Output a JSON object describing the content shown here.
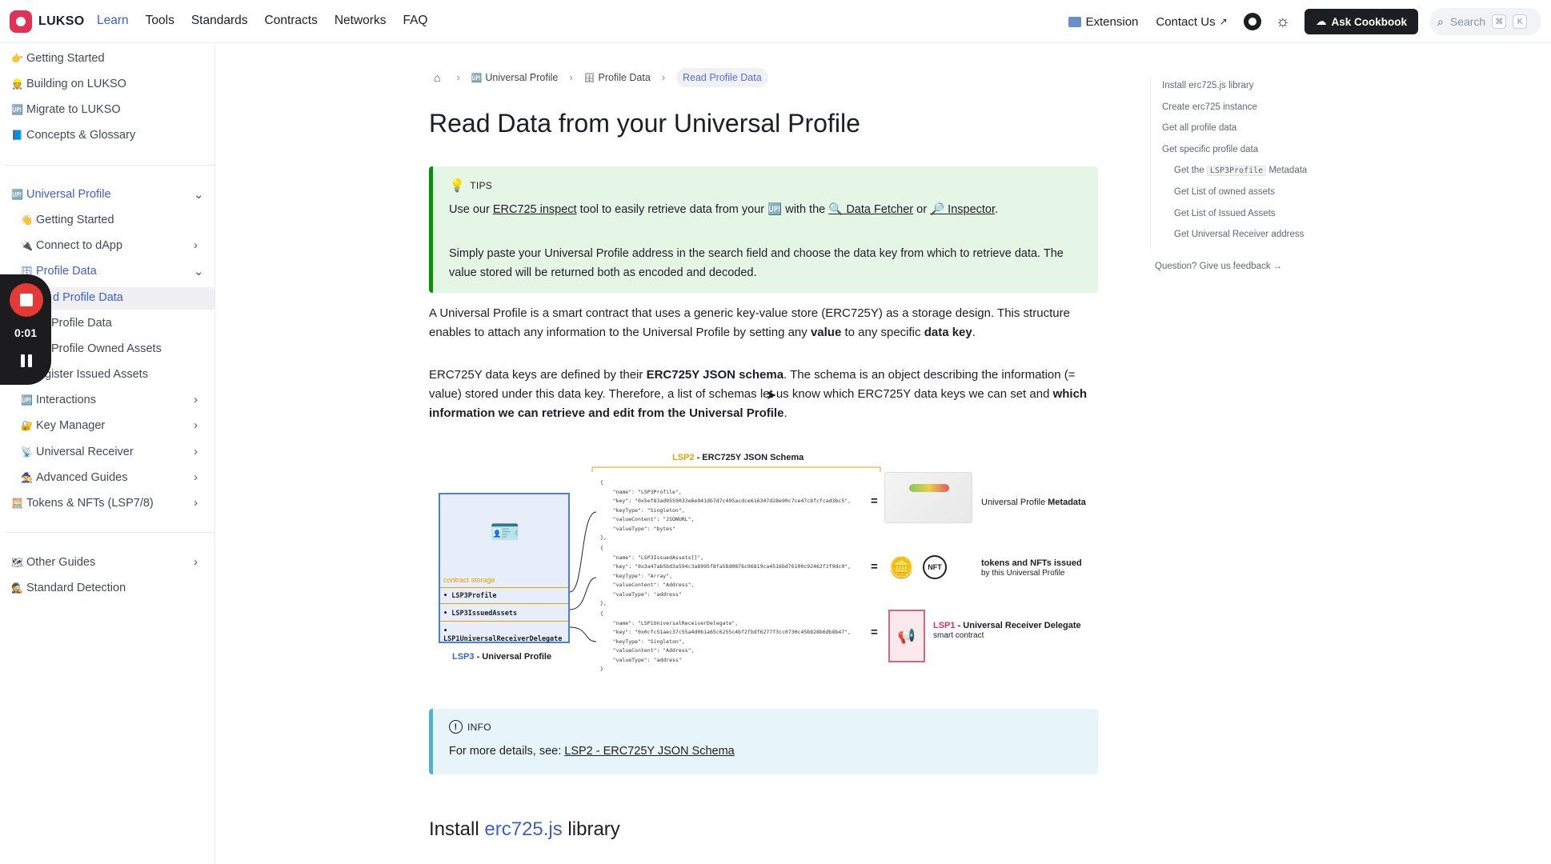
{
  "brand": {
    "name": "LUKSO"
  },
  "nav": {
    "links": [
      "Learn",
      "Tools",
      "Standards",
      "Contracts",
      "Networks",
      "FAQ"
    ],
    "extension": "Extension",
    "contact": "Contact Us",
    "ask": "Ask Cookbook",
    "search_placeholder": "Search",
    "kbd1": "⌘",
    "kbd2": "K"
  },
  "sidebar": {
    "items": [
      {
        "icon": "👉",
        "label": "Getting Started"
      },
      {
        "icon": "👷",
        "label": "Building on LUKSO"
      },
      {
        "icon": "🆙",
        "label": "Migrate to LUKSO"
      },
      {
        "icon": "📘",
        "label": "Concepts & Glossary"
      },
      {
        "icon": "🆙",
        "label": "Universal Profile"
      },
      {
        "icon": "👋",
        "label": "Getting Started"
      },
      {
        "icon": "🔌",
        "label": "Connect to dApp"
      },
      {
        "icon": "🗄",
        "label": "Profile Data"
      },
      {
        "icon": "",
        "label": "d Profile Data"
      },
      {
        "icon": "",
        "label": "Profile Data"
      },
      {
        "icon": "",
        "label": "Profile Owned Assets"
      },
      {
        "icon": "",
        "label": "gister Issued Assets"
      },
      {
        "icon": "🆙",
        "label": "Interactions"
      },
      {
        "icon": "🔐",
        "label": "Key Manager"
      },
      {
        "icon": "📡",
        "label": "Universal Receiver"
      },
      {
        "icon": "🧙",
        "label": "Advanced Guides"
      },
      {
        "icon": "🧮",
        "label": "Tokens & NFTs (LSP7/8)"
      },
      {
        "icon": "🗺",
        "label": "Other Guides"
      },
      {
        "icon": "🕵",
        "label": "Standard Detection"
      }
    ]
  },
  "recorder": {
    "time": "0:01"
  },
  "breadcrumb": {
    "items": [
      "Universal Profile",
      "Profile Data",
      "Read Profile Data"
    ]
  },
  "page": {
    "title": "Read Data from your Universal Profile"
  },
  "tip": {
    "label": "TIPS",
    "p1_a": "Use our ",
    "p1_link1": "ERC725 inspect",
    "p1_b": " tool to easily retrieve data from your 🆙 with the ",
    "p1_link2": "🔍 Data Fetcher",
    "p1_c": " or ",
    "p1_link3": "🔎 Inspector",
    "p1_d": ".",
    "p2": "Simply paste your Universal Profile address in the search field and choose the data key from which to retrieve data. The value stored will be returned both as encoded and decoded."
  },
  "body": {
    "p1_a": "A Universal Profile is a smart contract that uses a generic key-value store (ERC725Y) as a storage design. This structure enables to attach any information to the Universal Profile by setting any ",
    "p1_b": "value",
    "p1_c": " to any specific ",
    "p1_d": "data key",
    "p1_e": ".",
    "p2_a": "ERC725Y data keys are defined by their ",
    "p2_b": "ERC725Y JSON schema",
    "p2_c": ". The schema is an object describing the information (= value) stored under this data key. Therefore, a list of schemas let us know which ERC725Y data keys we can set and ",
    "p2_d": "which information we can retrieve and edit from the Universal Profile",
    "p2_e": "."
  },
  "diagram": {
    "title_prefix": "LSP2",
    "title": " - ERC725Y JSON Schema",
    "storage_label": "contract storage",
    "keys": [
      "LSP3Profile",
      "LSP3IssuedAssets",
      "LSP1UniversalReceiverDelegate"
    ],
    "lsp3_prefix": "LSP3",
    "lsp3": " - Universal Profile",
    "json1": "{\n    \"name\": \"LSP3Profile\",\n    \"key\": \"0x5ef83ad9559033e6e941db7d7c495acdce616347d28e90c7ce47cbfcfcad3bc5\",\n    \"keyType\": \"Singleton\",\n    \"valueContent\": \"JSONURL\",\n    \"valueType\": \"bytes\"\n},",
    "json2": "{\n    \"name\": \"LSP3IssuedAssets[]\",\n    \"key\": \"0x3a47ab5bd3a594c3a8995f8fa58d0876c96819ca4516bd76100c92462f2f9dc0\",\n    \"keyType\": \"Array\",\n    \"valueContent\": \"Address\",\n    \"valueType\": \"address\"\n},",
    "json3": "{\n    \"name\": \"LSP1UniversalReceiverDelegate\",\n    \"key\": \"0x0cfc51aec37c55a4d0b1a65c6255c4bf2fbdf6277f3cc0730c45b828b6db8b47\",\n    \"keyType\": \"Singleton\",\n    \"valueContent\": \"Address\",\n    \"valueType\": \"address\"\n}",
    "eq": "=",
    "meta_a": "Universal Profile ",
    "meta_b": "Metadata",
    "nft_badge": "NFT",
    "tokens_a": "tokens and NFTs issued",
    "tokens_b": "by this Universal Profile",
    "lsp1_prefix": "LSP1",
    "lsp1": " - Universal Receiver Delegate",
    "lsp1_sub": "smart contract"
  },
  "info": {
    "label": "INFO",
    "text": "For more details, see: ",
    "link": "LSP2 - ERC725Y JSON Schema"
  },
  "section": {
    "h2_a": "Install ",
    "h2_b": "erc725.js",
    "h2_c": " library"
  },
  "toc": {
    "items": [
      "Install erc725.js library",
      "Create erc725 instance",
      "Get all profile data",
      "Get specific profile data"
    ],
    "sub_code_pre": "Get the ",
    "sub_code": "LSP3Profile",
    "sub_code_post": " Metadata",
    "sub_items": [
      "Get List of owned assets",
      "Get List of Issued Assets",
      "Get Universal Receiver address"
    ],
    "feedback": "Question? Give us feedback →"
  }
}
